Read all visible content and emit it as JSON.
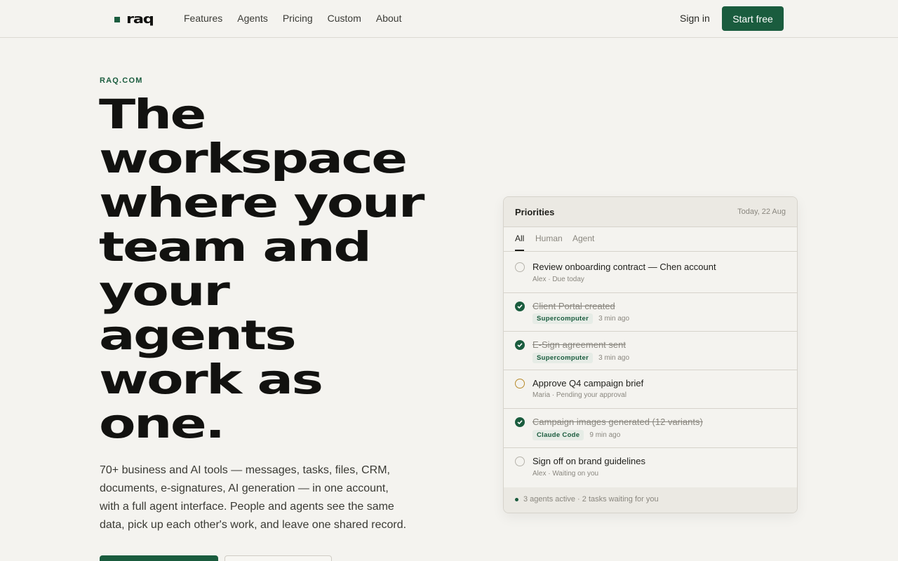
{
  "nav": {
    "logo_text": "raq",
    "links": [
      "Features",
      "Agents",
      "Pricing",
      "Custom",
      "About"
    ],
    "sign_in": "Sign in",
    "start_free": "Start free"
  },
  "hero": {
    "eyebrow": "RAQ.COM",
    "headline_lines": [
      "The",
      "workspace",
      "where your",
      "team and",
      "your",
      "agents",
      "work as",
      "one."
    ],
    "description": "70+ business and AI tools — messages, tasks, files, CRM, documents, e-signatures, AI generation — in one account, with a full agent interface. People and agents see the same data, pick up each other's work, and leave one shared record."
  },
  "priorities": {
    "title": "Priorities",
    "date": "Today, 22 Aug",
    "tabs": [
      "All",
      "Human",
      "Agent"
    ],
    "active_tab": "All",
    "rows": [
      {
        "title": "Review onboarding contract — Chen account",
        "meta": "Alex · Due today",
        "status": "open"
      },
      {
        "title": "Client Portal created",
        "agent": "Supercomputer",
        "time": "3 min ago",
        "status": "done"
      },
      {
        "title": "E-Sign agreement sent",
        "agent": "Supercomputer",
        "time": "3 min ago",
        "status": "done"
      },
      {
        "title": "Approve Q4 campaign brief",
        "meta": "Maria · Pending your approval",
        "status": "pending"
      },
      {
        "title": "Campaign images generated (12 variants)",
        "agent": "Claude Code",
        "time": "9 min ago",
        "status": "done"
      },
      {
        "title": "Sign off on brand guidelines",
        "meta": "Alex · Waiting on you",
        "status": "open"
      }
    ],
    "footer": "3 agents active · 2 tasks waiting for you"
  },
  "colors": {
    "brand": "#1a5c3e",
    "background": "#f4f3ef",
    "pending": "#b88a2a"
  }
}
